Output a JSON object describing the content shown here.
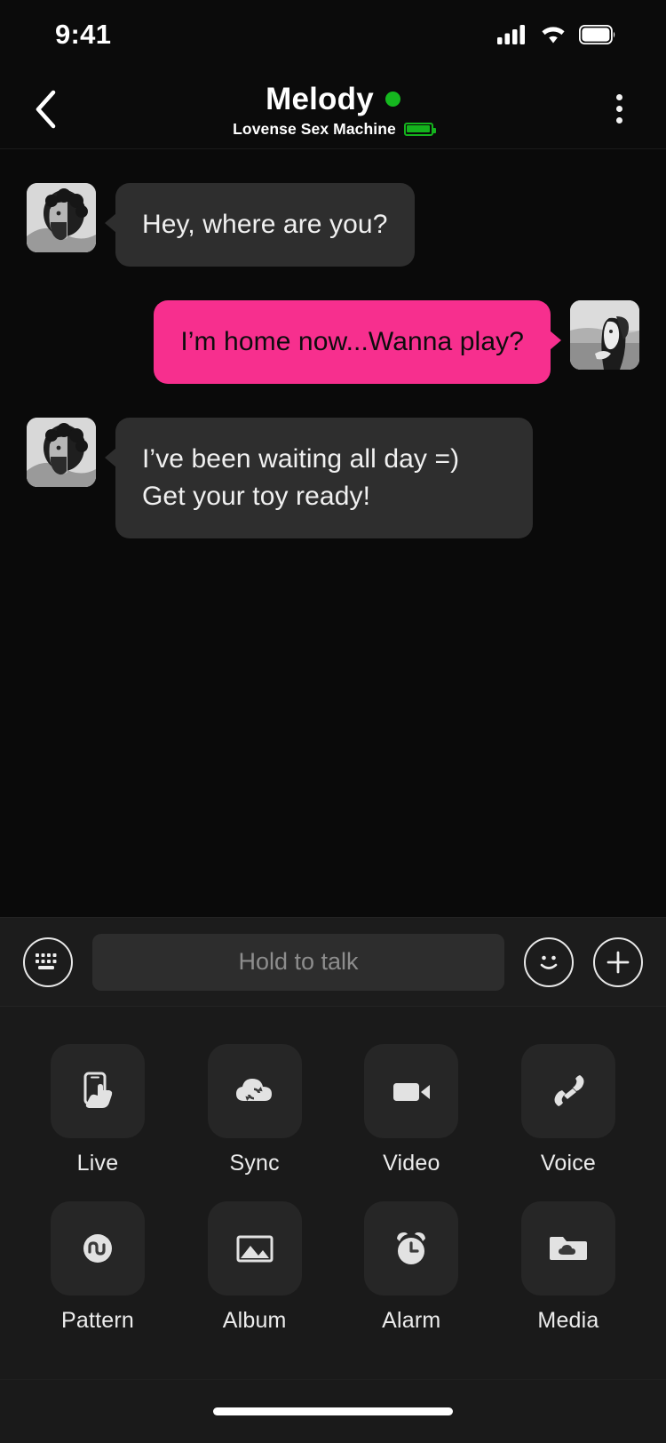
{
  "status_bar": {
    "time": "9:41",
    "icons": [
      "cellular-signal-icon",
      "wifi-icon",
      "battery-icon"
    ]
  },
  "header": {
    "back_icon": "chevron-left-icon",
    "title": "Melody",
    "online_indicator_color": "#15b81f",
    "subtitle": "Lovense Sex Machine",
    "device_battery_color": "#14b31d",
    "menu_icon": "overflow-menu-icon"
  },
  "conversation": {
    "messages": [
      {
        "sender": "them",
        "text": "Hey, where are you?",
        "avatar": "bearded-man-portrait"
      },
      {
        "sender": "me",
        "text": "I’m home now...Wanna play?",
        "avatar": "woman-profile-portrait"
      },
      {
        "sender": "them",
        "text": "I’ve been waiting all day =) Get your toy ready!",
        "avatar": "bearded-man-portrait"
      }
    ],
    "accent_color": "#f72f8e",
    "them_bubble_color": "#2e2e2e"
  },
  "input_bar": {
    "keyboard_icon": "keyboard-icon",
    "talk_placeholder": "Hold to talk",
    "emoji_icon": "smiley-icon",
    "add_icon": "plus-icon"
  },
  "action_panel": {
    "rows": [
      [
        {
          "label": "Live",
          "icon": "phone-touch-icon"
        },
        {
          "label": "Sync",
          "icon": "cloud-sync-icon"
        },
        {
          "label": "Video",
          "icon": "video-camera-icon"
        },
        {
          "label": "Voice",
          "icon": "phone-handset-icon"
        }
      ],
      [
        {
          "label": "Pattern",
          "icon": "wave-pattern-icon"
        },
        {
          "label": "Album",
          "icon": "image-icon"
        },
        {
          "label": "Alarm",
          "icon": "alarm-clock-icon"
        },
        {
          "label": "Media",
          "icon": "folder-cloud-icon"
        }
      ]
    ]
  },
  "home_indicator": "home-bar"
}
